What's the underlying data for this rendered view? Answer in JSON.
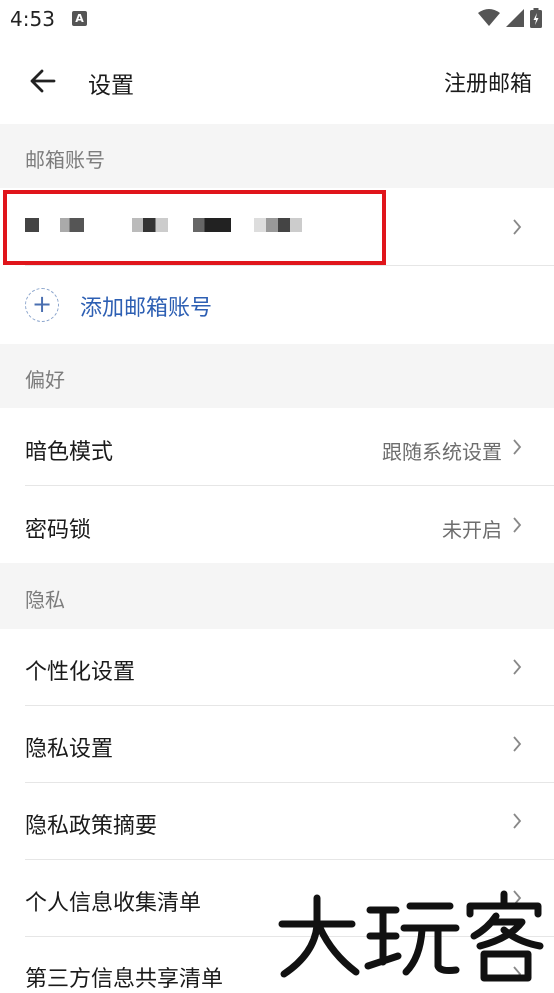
{
  "status_bar": {
    "time": "4:53",
    "notification_badge": "A"
  },
  "header": {
    "title": "设置",
    "register_label": "注册邮箱"
  },
  "sections": {
    "accounts": {
      "title": "邮箱账号",
      "add_label": "添加邮箱账号"
    },
    "preferences": {
      "title": "偏好",
      "items": [
        {
          "label": "暗色模式",
          "value": "跟随系统设置"
        },
        {
          "label": "密码锁",
          "value": "未开启"
        }
      ]
    },
    "privacy": {
      "title": "隐私",
      "items": [
        {
          "label": "个性化设置"
        },
        {
          "label": "隐私设置"
        },
        {
          "label": "隐私政策摘要"
        },
        {
          "label": "个人信息收集清单"
        },
        {
          "label": "第三方信息共享清单"
        }
      ]
    }
  },
  "watermark": {
    "text": "大玩客"
  },
  "colors": {
    "accent_blue": "#2d5fb3",
    "highlight_red": "#e0151b",
    "section_bg": "#f5f5f5"
  },
  "icons": [
    "back-arrow-icon",
    "chevron-right-icon",
    "plus-icon",
    "wifi-icon",
    "signal-icon",
    "battery-icon"
  ]
}
